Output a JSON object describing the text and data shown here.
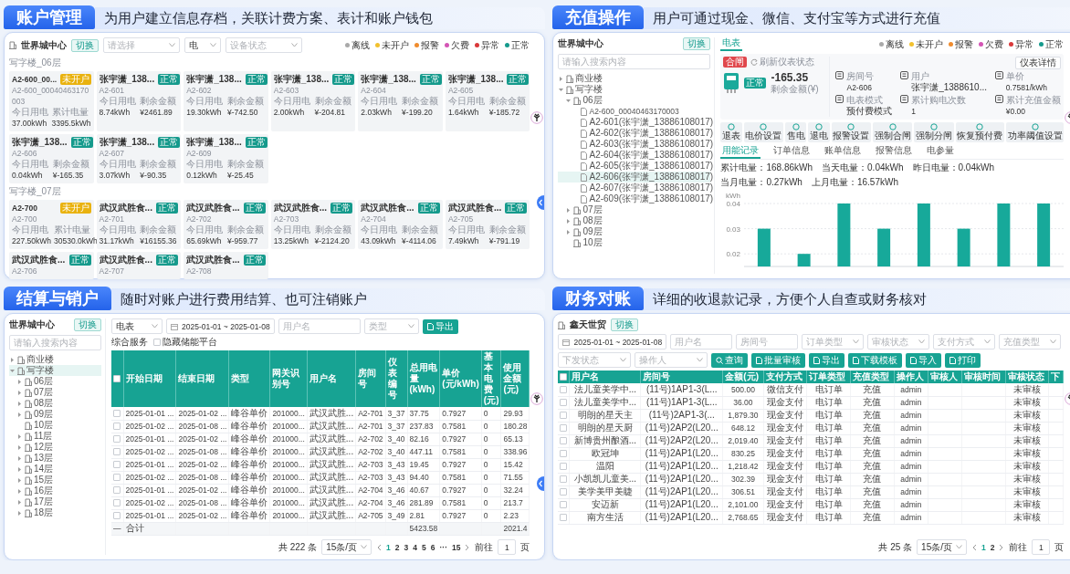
{
  "sections": [
    {
      "kind": "meter_cards",
      "title": "账户管理",
      "caption": "为用户建立信息存档，关联计费方案、表计和账户钱包",
      "site": "世界城中心",
      "switch": "切换",
      "filters": [
        {
          "placeholder": "请选择"
        },
        {
          "value": "电"
        },
        {
          "placeholder": "设备状态"
        }
      ],
      "legend": [
        {
          "label": "离线",
          "color": "#a9a9a9"
        },
        {
          "label": "未开户",
          "color": "#f2c12e"
        },
        {
          "label": "报警",
          "color": "#f08c2e"
        },
        {
          "label": "欠费",
          "color": "#d455b5"
        },
        {
          "label": "异常",
          "color": "#d9383a"
        },
        {
          "label": "正常",
          "color": "#159a8c"
        }
      ],
      "groups": [
        {
          "title": "写字楼_06层",
          "cards": [
            {
              "name": "A2-600_00...",
              "status": "未开户",
              "color": "#e9b20f",
              "id": "A2-600_00040463170003",
              "stats": [
                {
                  "label": "今日用电",
                  "value": "37.00kWh"
                },
                {
                  "label": "累计电量",
                  "value": "3395.5kWh"
                }
              ]
            },
            {
              "name": "张宇潇_138...",
              "status": "正常",
              "color": "#159a8c",
              "id": "A2-601",
              "stats": [
                {
                  "label": "今日用电",
                  "value": "8.74kWh"
                },
                {
                  "label": "剩余金额",
                  "value": "¥2461.89"
                }
              ]
            },
            {
              "name": "张宇潇_138...",
              "status": "正常",
              "color": "#159a8c",
              "id": "A2-602",
              "stats": [
                {
                  "label": "今日用电",
                  "value": "19.30kWh"
                },
                {
                  "label": "剩余金额",
                  "value": "¥-742.50"
                }
              ]
            },
            {
              "name": "张宇潇_138...",
              "status": "正常",
              "color": "#159a8c",
              "id": "A2-603",
              "stats": [
                {
                  "label": "今日用电",
                  "value": "2.00kWh"
                },
                {
                  "label": "剩余金额",
                  "value": "¥-204.81"
                }
              ]
            },
            {
              "name": "张宇潇_138...",
              "status": "正常",
              "color": "#159a8c",
              "id": "A2-604",
              "stats": [
                {
                  "label": "今日用电",
                  "value": "2.03kWh"
                },
                {
                  "label": "剩余金额",
                  "value": "¥-199.20"
                }
              ]
            },
            {
              "name": "张宇潇_138...",
              "status": "正常",
              "color": "#159a8c",
              "id": "A2-605",
              "stats": [
                {
                  "label": "今日用电",
                  "value": "1.64kWh"
                },
                {
                  "label": "剩余金额",
                  "value": "¥-185.72"
                }
              ]
            },
            {
              "name": "张宇潇_138...",
              "status": "正常",
              "color": "#159a8c",
              "id": "A2-606",
              "stats": [
                {
                  "label": "今日用电",
                  "value": "0.04kWh"
                },
                {
                  "label": "剩余金额",
                  "value": "¥-165.35"
                }
              ]
            },
            {
              "name": "张宇潇_138...",
              "status": "正常",
              "color": "#159a8c",
              "id": "A2-607",
              "stats": [
                {
                  "label": "今日用电",
                  "value": "3.07kWh"
                },
                {
                  "label": "剩余金额",
                  "value": "¥-90.35"
                }
              ]
            },
            {
              "name": "张宇潇_138...",
              "status": "正常",
              "color": "#159a8c",
              "id": "A2-609",
              "stats": [
                {
                  "label": "今日用电",
                  "value": "0.12kWh"
                },
                {
                  "label": "剩余金额",
                  "value": "¥-25.45"
                }
              ]
            }
          ]
        },
        {
          "title": "写字楼_07层",
          "cards": [
            {
              "name": "A2-700",
              "status": "未开户",
              "color": "#e9b20f",
              "id": "A2-700",
              "stats": [
                {
                  "label": "今日用电",
                  "value": "227.50kWh"
                },
                {
                  "label": "累计电量",
                  "value": "30530.0kWh"
                }
              ]
            },
            {
              "name": "武汉武胜食...",
              "status": "正常",
              "color": "#159a8c",
              "id": "A2-701",
              "stats": [
                {
                  "label": "今日用电",
                  "value": "31.17kWh"
                },
                {
                  "label": "剩余金额",
                  "value": "¥16155.36"
                }
              ]
            },
            {
              "name": "武汉武胜食...",
              "status": "正常",
              "color": "#159a8c",
              "id": "A2-702",
              "stats": [
                {
                  "label": "今日用电",
                  "value": "65.69kWh"
                },
                {
                  "label": "剩余金额",
                  "value": "¥-959.77"
                }
              ]
            },
            {
              "name": "武汉武胜食...",
              "status": "正常",
              "color": "#159a8c",
              "id": "A2-703",
              "stats": [
                {
                  "label": "今日用电",
                  "value": "13.25kWh"
                },
                {
                  "label": "剩余金额",
                  "value": "¥-2124.20"
                }
              ]
            },
            {
              "name": "武汉武胜食...",
              "status": "正常",
              "color": "#159a8c",
              "id": "A2-704",
              "stats": [
                {
                  "label": "今日用电",
                  "value": "43.09kWh"
                },
                {
                  "label": "剩余金额",
                  "value": "¥-4114.06"
                }
              ]
            },
            {
              "name": "武汉武胜食...",
              "status": "正常",
              "color": "#159a8c",
              "id": "A2-705",
              "stats": [
                {
                  "label": "今日用电",
                  "value": "7.49kWh"
                },
                {
                  "label": "剩余金额",
                  "value": "¥-791.19"
                }
              ]
            },
            {
              "name": "武汉武胜食...",
              "status": "正常",
              "color": "#159a8c",
              "id": "A2-706"
            },
            {
              "name": "武汉武胜食...",
              "status": "正常",
              "color": "#159a8c",
              "id": "A2-707"
            },
            {
              "name": "武汉武胜食...",
              "status": "正常",
              "color": "#159a8c",
              "id": "A2-708"
            }
          ]
        }
      ]
    },
    {
      "kind": "meter_detail",
      "title": "充值操作",
      "caption": "用户可通过现金、微信、支付宝等方式进行充值",
      "site": "世界城中心",
      "switch": "切换",
      "search": {
        "placeholder": "请输入搜索内容"
      },
      "tree": [
        {
          "label": "商业楼",
          "kind": "group",
          "expanded": false,
          "selected": false
        },
        {
          "label": "写字楼",
          "kind": "group",
          "expanded": true,
          "selected": false,
          "children": [
            {
              "label": "06层",
              "kind": "group",
              "expanded": true,
              "selected": false,
              "children": [
                {
                  "label": "A2-600_00040463170003",
                  "kind": "meter",
                  "selected": false
                },
                {
                  "label": "A2-601(张宇潇_13886108017)",
                  "kind": "meter",
                  "selected": false
                },
                {
                  "label": "A2-602(张宇潇_13886108017)",
                  "kind": "meter",
                  "selected": false
                },
                {
                  "label": "A2-603(张宇潇_13886108017)",
                  "kind": "meter",
                  "selected": false
                },
                {
                  "label": "A2-604(张宇潇_13886108017)",
                  "kind": "meter",
                  "selected": false
                },
                {
                  "label": "A2-605(张宇潇_13886108017)",
                  "kind": "meter",
                  "selected": false
                },
                {
                  "label": "A2-606(张宇潇_13886108017)",
                  "kind": "meter",
                  "selected": true
                },
                {
                  "label": "A2-607(张宇潇_13886108017)",
                  "kind": "meter",
                  "selected": false
                },
                {
                  "label": "A2-609(张宇潇_13886108017)",
                  "kind": "meter",
                  "selected": false
                }
              ]
            },
            {
              "label": "07层",
              "kind": "group",
              "expanded": false,
              "selected": false
            },
            {
              "label": "08层",
              "kind": "group",
              "expanded": false,
              "selected": false
            },
            {
              "label": "09层",
              "kind": "group",
              "expanded": false,
              "selected": false
            },
            {
              "label": "10层",
              "kind": "group",
              "selected": false
            }
          ]
        }
      ],
      "tabs": [
        {
          "label": "电表",
          "selected": true
        }
      ],
      "legend": [
        {
          "label": "离线",
          "color": "#a9a9a9"
        },
        {
          "label": "未开户",
          "color": "#f2c12e"
        },
        {
          "label": "报警",
          "color": "#f08c2e"
        },
        {
          "label": "欠费",
          "color": "#d455b5"
        },
        {
          "label": "异常",
          "color": "#d9383a"
        },
        {
          "label": "正常",
          "color": "#159a8c"
        }
      ],
      "meter": {
        "switch_state": "合闸",
        "refresh": "刷新仪表状态",
        "status": "正常",
        "balance": "-165.35",
        "balance_label": "剩余金额(¥)",
        "details_button": "仪表详情",
        "info": [
          {
            "label": "房间号",
            "value": "A2-606"
          },
          {
            "label": "用户",
            "value": "张宇潇_1388610..."
          },
          {
            "label": "单价",
            "value": "0.7581/kWh"
          },
          {
            "label": "电表模式",
            "value": "预付费模式"
          },
          {
            "label": "累计购电次数",
            "value": "1"
          },
          {
            "label": "累计充值金额",
            "value": "¥0.00"
          }
        ]
      },
      "actions": [
        "退表",
        "电价设置",
        "售电",
        "退电",
        "报警设置",
        "强制合闸",
        "强制分闸",
        "恢复预付费",
        "功率阈值设置"
      ],
      "record_tabs": [
        {
          "label": "用能记录",
          "selected": true
        },
        {
          "label": "订单信息",
          "selected": false
        },
        {
          "label": "账单信息",
          "selected": false
        },
        {
          "label": "报警信息",
          "selected": false
        },
        {
          "label": "电参量",
          "selected": false
        }
      ],
      "stats": [
        "累计电量：168.86kWh",
        "当天电量：0.04kWh",
        "昨日电量：0.04kWh",
        "当月电量：0.27kWh",
        "上月电量：16.57kWh"
      ],
      "chart_data": {
        "type": "bar",
        "ylabel": "kWh",
        "grid": true,
        "ylim": [
          0.015,
          0.04
        ],
        "yticks": [
          0.02,
          0.03,
          0.04
        ],
        "values": [
          0.03,
          0.02,
          0.04,
          0.03,
          0.04,
          0.03,
          0.04,
          0.04
        ]
      }
    },
    {
      "kind": "settlement",
      "title": "结算与销户",
      "caption": "随时对账户进行费用结算、也可注销账户",
      "site": "世界城中心",
      "switch": "切换",
      "search": {
        "placeholder": "请输入搜索内容"
      },
      "tree": [
        {
          "label": "商业楼",
          "kind": "group",
          "expanded": false,
          "selected": false
        },
        {
          "label": "写字楼",
          "kind": "group",
          "expanded": true,
          "selected": true,
          "children": [
            {
              "label": "06层",
              "kind": "group",
              "expanded": false,
              "selected": false
            },
            {
              "label": "07层",
              "kind": "group",
              "expanded": false,
              "selected": false
            },
            {
              "label": "08层",
              "kind": "group",
              "expanded": false,
              "selected": false
            },
            {
              "label": "09层",
              "kind": "group",
              "expanded": false,
              "selected": false
            },
            {
              "label": "10层",
              "kind": "group",
              "selected": false
            },
            {
              "label": "11层",
              "kind": "group",
              "expanded": false,
              "selected": false
            },
            {
              "label": "12层",
              "kind": "group",
              "expanded": false,
              "selected": false
            },
            {
              "label": "13层",
              "kind": "group",
              "expanded": false,
              "selected": false
            },
            {
              "label": "14层",
              "kind": "group",
              "expanded": false,
              "selected": false
            },
            {
              "label": "15层",
              "kind": "group",
              "expanded": false,
              "selected": false
            },
            {
              "label": "16层",
              "kind": "group",
              "expanded": false,
              "selected": false
            },
            {
              "label": "17层",
              "kind": "group",
              "expanded": false,
              "selected": false
            },
            {
              "label": "18层",
              "kind": "group",
              "expanded": false,
              "selected": false
            }
          ]
        }
      ],
      "filters": [
        {
          "value": "电表"
        },
        {
          "kind": "date",
          "value": "2025-01-01 ~ 2025-01-08"
        },
        {
          "kind": "input",
          "placeholder": "用户名"
        },
        {
          "placeholder": "类型"
        }
      ],
      "export_button": "导出",
      "service_label": "综合服务",
      "hide_option": {
        "label": "隐藏储能平台",
        "checked": false
      },
      "table": {
        "select_all": false,
        "columns": [
          "开始日期",
          "结束日期",
          "类型",
          "网关识别号",
          "用户名",
          "房间号",
          "仪表编号",
          "总用电量(kWh)",
          "单价(元/kWh)",
          "基本电费(元)",
          "使用金额(元)"
        ],
        "rows": [
          {
            "checked": false,
            "cells": [
              "2025-01-01 ...",
              "2025-01-02 ...",
              "峰谷单价",
              "201000...",
              "武汉武胜...",
              "A2-701",
              "3_37",
              "37.75",
              "0.7927",
              "0",
              "29.93"
            ]
          },
          {
            "checked": false,
            "cells": [
              "2025-01-02 ...",
              "2025-01-08 ...",
              "峰谷单价",
              "201000...",
              "武汉武胜...",
              "A2-701",
              "3_37",
              "237.83",
              "0.7581",
              "0",
              "180.28"
            ]
          },
          {
            "checked": false,
            "cells": [
              "2025-01-01 ...",
              "2025-01-02 ...",
              "峰谷单价",
              "201000...",
              "武汉武胜...",
              "A2-702",
              "3_40",
              "82.16",
              "0.7927",
              "0",
              "65.13"
            ]
          },
          {
            "checked": false,
            "cells": [
              "2025-01-02 ...",
              "2025-01-08 ...",
              "峰谷单价",
              "201000...",
              "武汉武胜...",
              "A2-702",
              "3_40",
              "447.11",
              "0.7581",
              "0",
              "338.96"
            ]
          },
          {
            "checked": false,
            "cells": [
              "2025-01-01 ...",
              "2025-01-02 ...",
              "峰谷单价",
              "201000...",
              "武汉武胜...",
              "A2-703",
              "3_43",
              "19.45",
              "0.7927",
              "0",
              "15.42"
            ]
          },
          {
            "checked": false,
            "cells": [
              "2025-01-02 ...",
              "2025-01-08 ...",
              "峰谷单价",
              "201000...",
              "武汉武胜...",
              "A2-703",
              "3_43",
              "94.40",
              "0.7581",
              "0",
              "71.55"
            ]
          },
          {
            "checked": false,
            "cells": [
              "2025-01-01 ...",
              "2025-01-02 ...",
              "峰谷单价",
              "201000...",
              "武汉武胜...",
              "A2-704",
              "3_46",
              "40.67",
              "0.7927",
              "0",
              "32.24"
            ]
          },
          {
            "checked": false,
            "cells": [
              "2025-01-02 ...",
              "2025-01-08 ...",
              "峰谷单价",
              "201000...",
              "武汉武胜...",
              "A2-704",
              "3_46",
              "281.89",
              "0.7581",
              "0",
              "213.7"
            ]
          },
          {
            "checked": false,
            "cells": [
              "2025-01-01 ...",
              "2025-01-02 ...",
              "峰谷单价",
              "201000...",
              "武汉武胜...",
              "A2-705",
              "3_49",
              "2.81",
              "0.7927",
              "0",
              "2.23"
            ]
          }
        ],
        "total": {
          "marker": "—",
          "label": "合计",
          "energy": "5423.58",
          "amount": "2021.4"
        }
      },
      "pager": {
        "total": "共 222 条",
        "page_size": "15条/页",
        "pages": [
          {
            "label": "1",
            "selected": true
          },
          {
            "label": "2",
            "selected": false
          },
          {
            "label": "3",
            "selected": false
          },
          {
            "label": "4",
            "selected": false
          },
          {
            "label": "5",
            "selected": false
          },
          {
            "label": "6",
            "selected": false
          },
          {
            "label": "···",
            "selected": false
          },
          {
            "label": "15",
            "selected": false
          }
        ],
        "goto": "前往",
        "goto_value": "1",
        "goto_unit": "页"
      }
    },
    {
      "kind": "finance",
      "title": "财务对账",
      "caption": "详细的收退款记录，方便个人自查或财务核对",
      "site": "鑫天世贸",
      "switch": "切换",
      "filters": [
        [
          {
            "kind": "date",
            "value": "2025-01-01 ~ 2025-01-08"
          },
          {
            "kind": "input",
            "placeholder": "用户名"
          },
          {
            "kind": "input",
            "placeholder": "房间号"
          },
          {
            "placeholder": "订单类型"
          },
          {
            "placeholder": "审核状态"
          },
          {
            "placeholder": "支付方式"
          },
          {
            "placeholder": "充值类型"
          }
        ],
        [
          {
            "placeholder": "下发状态"
          },
          {
            "placeholder": "操作人"
          }
        ]
      ],
      "buttons": [
        {
          "kind": "search",
          "label": "查询"
        },
        {
          "kind": "action",
          "label": "批量审核"
        },
        {
          "kind": "action",
          "label": "导出"
        },
        {
          "kind": "action",
          "label": "下载模板"
        },
        {
          "kind": "action",
          "label": "导入"
        },
        {
          "kind": "action",
          "label": "打印"
        }
      ],
      "table": {
        "select_all": false,
        "columns": [
          {
            "label": "用户名",
            "kind": "text"
          },
          {
            "label": "房间号",
            "kind": "text"
          },
          {
            "label": "金额(元)",
            "kind": "text"
          },
          {
            "label": "支付方式",
            "kind": "text"
          },
          {
            "label": "订单类型",
            "kind": "text"
          },
          {
            "label": "充值类型",
            "kind": "text"
          },
          {
            "label": "操作人",
            "kind": "text"
          },
          {
            "label": "审核人",
            "kind": "blank"
          },
          {
            "label": "审核时间",
            "kind": "blank"
          },
          {
            "label": "审核状态",
            "kind": "text"
          },
          {
            "label": "下",
            "kind": "blank"
          }
        ],
        "rows": [
          {
            "checked": false,
            "cells": [
              "法儿童美学中...",
              "(11号)1AP1-3(L...",
              "500.00",
              "微信支付",
              "电订单",
              "充值",
              "admin",
              "未审核"
            ]
          },
          {
            "checked": false,
            "cells": [
              "法儿童美学中...",
              "(11号)1AP1-3(L...",
              "36.00",
              "现金支付",
              "电订单",
              "充值",
              "admin",
              "未审核"
            ]
          },
          {
            "checked": false,
            "cells": [
              "明朗的星天主",
              "(11号)2AP1-3(...",
              "1,879.30",
              "现金支付",
              "电订单",
              "充值",
              "admin",
              "未审核"
            ]
          },
          {
            "checked": false,
            "cells": [
              "明朗的星天厨",
              "(11号)2AP2(L20...",
              "648.12",
              "现金支付",
              "电订单",
              "充值",
              "admin",
              "未审核"
            ]
          },
          {
            "checked": false,
            "cells": [
              "新博贵州酿酒...",
              "(11号)2AP2(L20...",
              "2,019.40",
              "现金支付",
              "电订单",
              "充值",
              "admin",
              "未审核"
            ]
          },
          {
            "checked": false,
            "cells": [
              "欧冠坤",
              "(11号)2AP1(L20...",
              "830.25",
              "现金支付",
              "电订单",
              "充值",
              "admin",
              "未审核"
            ]
          },
          {
            "checked": false,
            "cells": [
              "温阳",
              "(11号)2AP1(L20...",
              "1,218.42",
              "现金支付",
              "电订单",
              "充值",
              "admin",
              "未审核"
            ]
          },
          {
            "checked": false,
            "cells": [
              "小凯凯儿童美...",
              "(11号)2AP1(L20...",
              "302.39",
              "现金支付",
              "电订单",
              "充值",
              "admin",
              "未审核"
            ]
          },
          {
            "checked": false,
            "cells": [
              "美学美甲美睫",
              "(11号)2AP1(L20...",
              "306.51",
              "现金支付",
              "电订单",
              "充值",
              "admin",
              "未审核"
            ]
          },
          {
            "checked": false,
            "cells": [
              "安迈新",
              "(11号)2AP1(L20...",
              "2,101.00",
              "现金支付",
              "电订单",
              "充值",
              "admin",
              "未审核"
            ]
          },
          {
            "checked": false,
            "cells": [
              "南方生活",
              "(11号)2AP1(L20...",
              "2,768.65",
              "现金支付",
              "电订单",
              "充值",
              "admin",
              "未审核"
            ]
          }
        ]
      },
      "pager": {
        "total": "共 25 条",
        "page_size": "15条/页",
        "pages": [
          {
            "label": "1",
            "selected": true
          },
          {
            "label": "2",
            "selected": false
          }
        ],
        "goto": "前往",
        "goto_value": "1",
        "goto_unit": "页"
      }
    }
  ]
}
